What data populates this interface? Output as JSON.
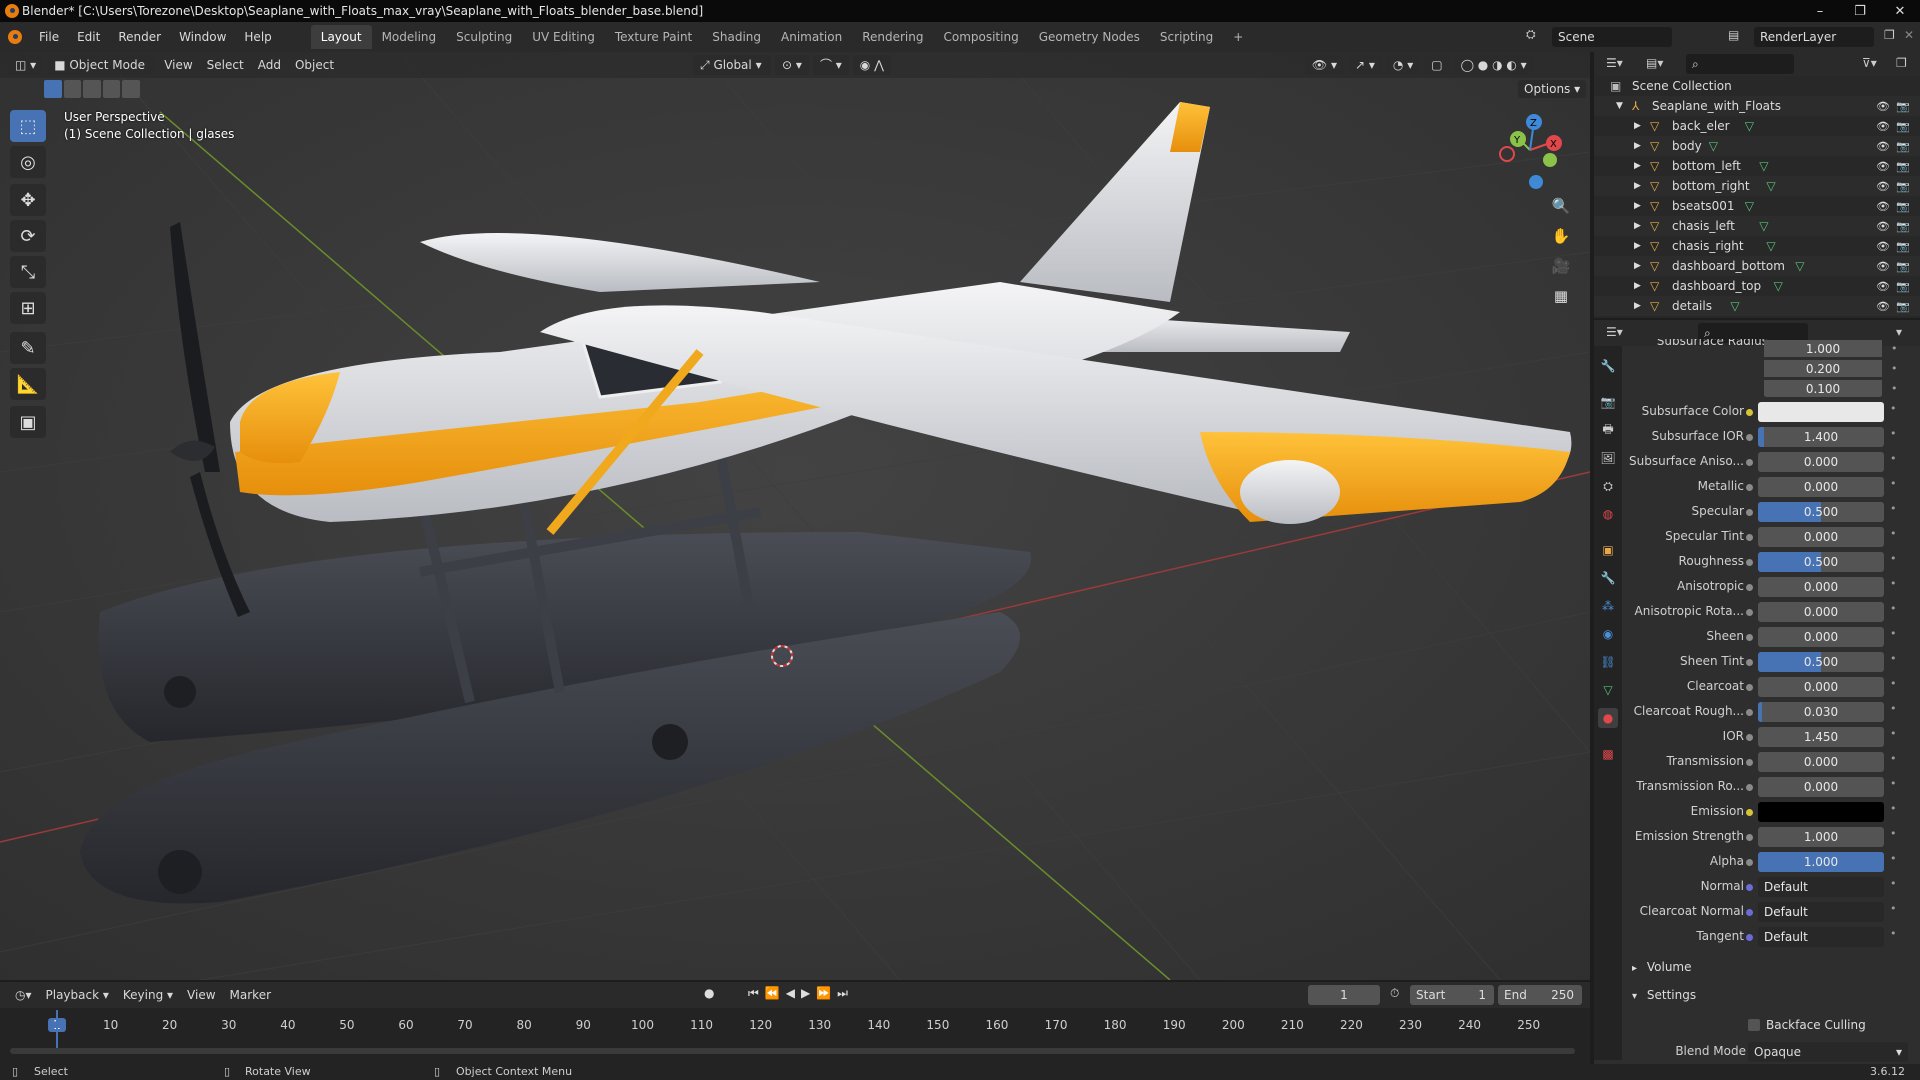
{
  "window": {
    "title": "Blender* [C:\\Users\\Torezone\\Desktop\\Seaplane_with_Floats_max_vray\\Seaplane_with_Floats_blender_base.blend]",
    "minimize": "–",
    "restore": "❐",
    "close": "✕"
  },
  "menubar": {
    "items": [
      "File",
      "Edit",
      "Render",
      "Window",
      "Help"
    ],
    "workspaces": [
      "Layout",
      "Modeling",
      "Sculpting",
      "UV Editing",
      "Texture Paint",
      "Shading",
      "Animation",
      "Rendering",
      "Compositing",
      "Geometry Nodes",
      "Scripting"
    ],
    "active_workspace": "Layout",
    "add_tab": "+",
    "scene": "Scene",
    "view_layer": "RenderLayer"
  },
  "viewport": {
    "mode": "Object Mode",
    "menus": [
      "View",
      "Select",
      "Add",
      "Object"
    ],
    "transform_orientation": "Global",
    "options": "Options",
    "overlay_line1": "User Perspective",
    "overlay_line2": "(1) Scene Collection | glases",
    "axis_labels": {
      "x": "X",
      "y": "Y",
      "z": "Z"
    }
  },
  "outliner": {
    "root": "Scene Collection",
    "collection": "Seaplane_with_Floats",
    "objects": [
      "back_eler",
      "body",
      "bottom_left",
      "bottom_right",
      "bseats001",
      "chasis_left",
      "chasis_right",
      "dashboard_bottom",
      "dashboard_top",
      "details"
    ]
  },
  "properties": {
    "radius_values": [
      {
        "value": "1.000",
        "fill": 0
      },
      {
        "value": "0.200",
        "fill": 0
      },
      {
        "value": "0.100",
        "fill": 0
      }
    ],
    "partial_label": "Subsurface Radius",
    "rows": [
      {
        "label": "Subsurface Color",
        "type": "color",
        "color": "#e8e8e8",
        "dot": "#d8c23a"
      },
      {
        "label": "Subsurface IOR",
        "value": "1.400",
        "fill": 0.05,
        "dot": "#8a8a8a"
      },
      {
        "label": "Subsurface Aniso...",
        "value": "0.000",
        "fill": 0,
        "dot": "#8a8a8a"
      },
      {
        "label": "Metallic",
        "value": "0.000",
        "fill": 0,
        "dot": "#8a8a8a"
      },
      {
        "label": "Specular",
        "value": "0.500",
        "fill": 0.5,
        "dot": "#8a8a8a"
      },
      {
        "label": "Specular Tint",
        "value": "0.000",
        "fill": 0,
        "dot": "#8a8a8a"
      },
      {
        "label": "Roughness",
        "value": "0.500",
        "fill": 0.5,
        "dot": "#8a8a8a"
      },
      {
        "label": "Anisotropic",
        "value": "0.000",
        "fill": 0,
        "dot": "#8a8a8a"
      },
      {
        "label": "Anisotropic Rota...",
        "value": "0.000",
        "fill": 0,
        "dot": "#8a8a8a"
      },
      {
        "label": "Sheen",
        "value": "0.000",
        "fill": 0,
        "dot": "#8a8a8a"
      },
      {
        "label": "Sheen Tint",
        "value": "0.500",
        "fill": 0.5,
        "dot": "#8a8a8a"
      },
      {
        "label": "Clearcoat",
        "value": "0.000",
        "fill": 0,
        "dot": "#8a8a8a"
      },
      {
        "label": "Clearcoat Rough...",
        "value": "0.030",
        "fill": 0.03,
        "dot": "#8a8a8a"
      },
      {
        "label": "IOR",
        "value": "1.450",
        "fill": 0,
        "dot": "#8a8a8a"
      },
      {
        "label": "Transmission",
        "value": "0.000",
        "fill": 0,
        "dot": "#8a8a8a"
      },
      {
        "label": "Transmission Ro...",
        "value": "0.000",
        "fill": 0,
        "dot": "#8a8a8a"
      },
      {
        "label": "Emission",
        "type": "color",
        "color": "#000000",
        "dot": "#d8c23a"
      },
      {
        "label": "Emission Strength",
        "value": "1.000",
        "fill": 0,
        "dot": "#8a8a8a"
      },
      {
        "label": "Alpha",
        "value": "1.000",
        "fill": 1,
        "dot": "#8a8a8a"
      },
      {
        "label": "Normal",
        "type": "link",
        "value": "Default",
        "dot": "#6b6bd6"
      },
      {
        "label": "Clearcoat Normal",
        "type": "link",
        "value": "Default",
        "dot": "#6b6bd6"
      },
      {
        "label": "Tangent",
        "type": "link",
        "value": "Default",
        "dot": "#6b6bd6"
      }
    ],
    "panels": {
      "volume": "Volume",
      "settings": "Settings"
    },
    "backface_culling": "Backface Culling",
    "blend_mode_label": "Blend Mode",
    "blend_mode_value": "Opaque"
  },
  "timeline": {
    "menus": [
      "Playback",
      "Keying",
      "View",
      "Marker"
    ],
    "current_frame": "1",
    "start_label": "Start",
    "start": "1",
    "end_label": "End",
    "end": "250",
    "ticks": [
      "1",
      "10",
      "20",
      "30",
      "40",
      "50",
      "60",
      "70",
      "80",
      "90",
      "100",
      "110",
      "120",
      "130",
      "140",
      "150",
      "160",
      "170",
      "180",
      "190",
      "200",
      "210",
      "220",
      "230",
      "240",
      "250"
    ]
  },
  "statusbar": {
    "select": "Select",
    "rotate": "Rotate View",
    "context": "Object Context Menu",
    "version": "3.6.12"
  },
  "colors": {
    "accent": "#4772b3",
    "orange": "#e87d0d",
    "plane_yellow": "#f0a81c"
  }
}
